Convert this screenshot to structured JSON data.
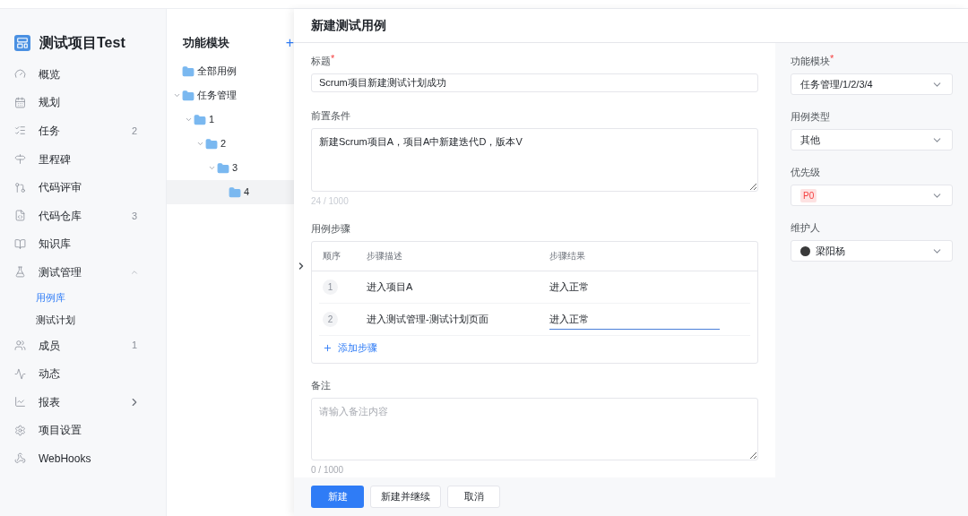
{
  "project": {
    "title": "测试项目Test"
  },
  "sidebar": {
    "items": [
      {
        "label": "概览",
        "selected": false
      },
      {
        "label": "规划",
        "selected": false
      },
      {
        "label": "任务",
        "count": "2",
        "selected": false
      },
      {
        "label": "里程碑",
        "selected": false
      },
      {
        "label": "代码评审",
        "selected": false
      },
      {
        "label": "代码仓库",
        "count": "3",
        "selected": false
      },
      {
        "label": "知识库",
        "selected": false
      },
      {
        "label": "测试管理",
        "selected": false,
        "expanded": true,
        "children": [
          {
            "label": "用例库",
            "selected": true
          },
          {
            "label": "测试计划",
            "selected": false
          }
        ]
      },
      {
        "label": "成员",
        "count": "1",
        "selected": false
      },
      {
        "label": "动态",
        "selected": false
      },
      {
        "label": "报表",
        "selected": false,
        "expanded": false
      },
      {
        "label": "项目设置",
        "selected": false
      },
      {
        "label": "WebHooks",
        "selected": false
      }
    ]
  },
  "modules": {
    "title": "功能模块",
    "add": "+",
    "tree": [
      {
        "label": "全部用例",
        "selected": false
      },
      {
        "label": "任务管理",
        "selected": false,
        "expanded": true,
        "children": [
          {
            "label": "1",
            "selected": false,
            "expanded": true,
            "children": [
              {
                "label": "2",
                "selected": false,
                "expanded": true,
                "children": [
                  {
                    "label": "3",
                    "selected": false,
                    "expanded": true,
                    "children": [
                      {
                        "label": "4",
                        "selected": true
                      }
                    ]
                  }
                ]
              }
            ]
          }
        ]
      }
    ]
  },
  "drawer": {
    "title": "新建测试用例",
    "title_field": {
      "label": "标题",
      "required_mark": "*",
      "value": "Scrum项目新建测试计划成功"
    },
    "precondition": {
      "label": "前置条件",
      "value": "新建Scrum项目A，项目A中新建迭代D，版本V",
      "counter": "24 / 1000"
    },
    "steps": {
      "label": "用例步骤",
      "columns": [
        "顺序",
        "步骤描述",
        "步骤结果"
      ],
      "rows": [
        {
          "index": "1",
          "description": "进入项目A",
          "result": "进入正常",
          "editing": false
        },
        {
          "index": "2",
          "description": "进入测试管理-测试计划页面",
          "result": "进入正常",
          "editing": true
        }
      ],
      "add": "添加步骤"
    },
    "remarks": {
      "label": "备注",
      "placeholder": "请输入备注内容",
      "counter": "0 / 1000"
    },
    "buttons": [
      {
        "label": "新建",
        "primary": true
      },
      {
        "label": "新建并继续",
        "primary": false
      },
      {
        "label": "取消",
        "primary": false
      }
    ],
    "side_fields": [
      {
        "label": "功能模块",
        "required_mark": "*",
        "kind": "text",
        "value": "任务管理/1/2/3/4"
      },
      {
        "label": "用例类型",
        "kind": "text",
        "value": "其他"
      },
      {
        "label": "优先级",
        "kind": "tag",
        "value": "P0"
      },
      {
        "label": "维护人",
        "kind": "user",
        "value": "梁阳杨"
      }
    ]
  }
}
